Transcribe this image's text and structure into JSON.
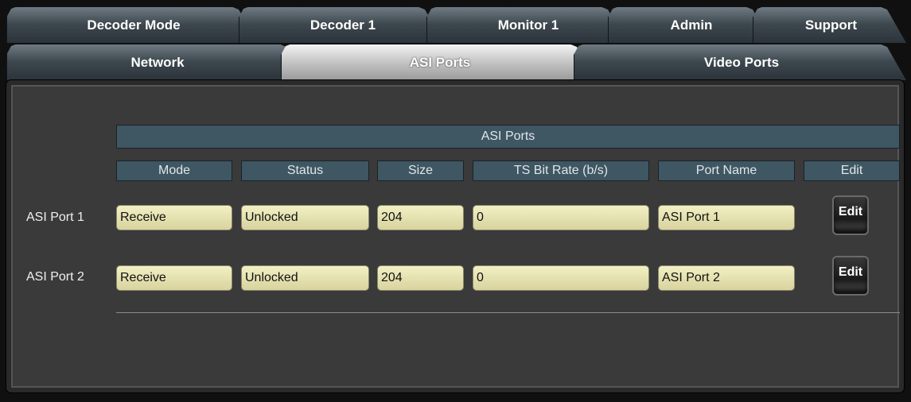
{
  "tabs_top": [
    {
      "label": "Decoder Mode"
    },
    {
      "label": "Decoder 1"
    },
    {
      "label": "Monitor 1"
    },
    {
      "label": "Admin"
    },
    {
      "label": "Support"
    }
  ],
  "tabs_bottom": [
    {
      "label": "Network"
    },
    {
      "label": "ASI Ports"
    },
    {
      "label": "Video Ports"
    }
  ],
  "table": {
    "title": "ASI Ports",
    "columns": [
      "Mode",
      "Status",
      "Size",
      "TS Bit Rate (b/s)",
      "Port Name",
      "Edit"
    ],
    "rows": [
      {
        "label": "ASI Port 1",
        "mode": "Receive",
        "status": "Unlocked",
        "size": "204",
        "bitrate": "0",
        "port_name": "ASI Port 1",
        "edit": "Edit"
      },
      {
        "label": "ASI Port 2",
        "mode": "Receive",
        "status": "Unlocked",
        "size": "204",
        "bitrate": "0",
        "port_name": "ASI Port 2",
        "edit": "Edit"
      }
    ]
  }
}
